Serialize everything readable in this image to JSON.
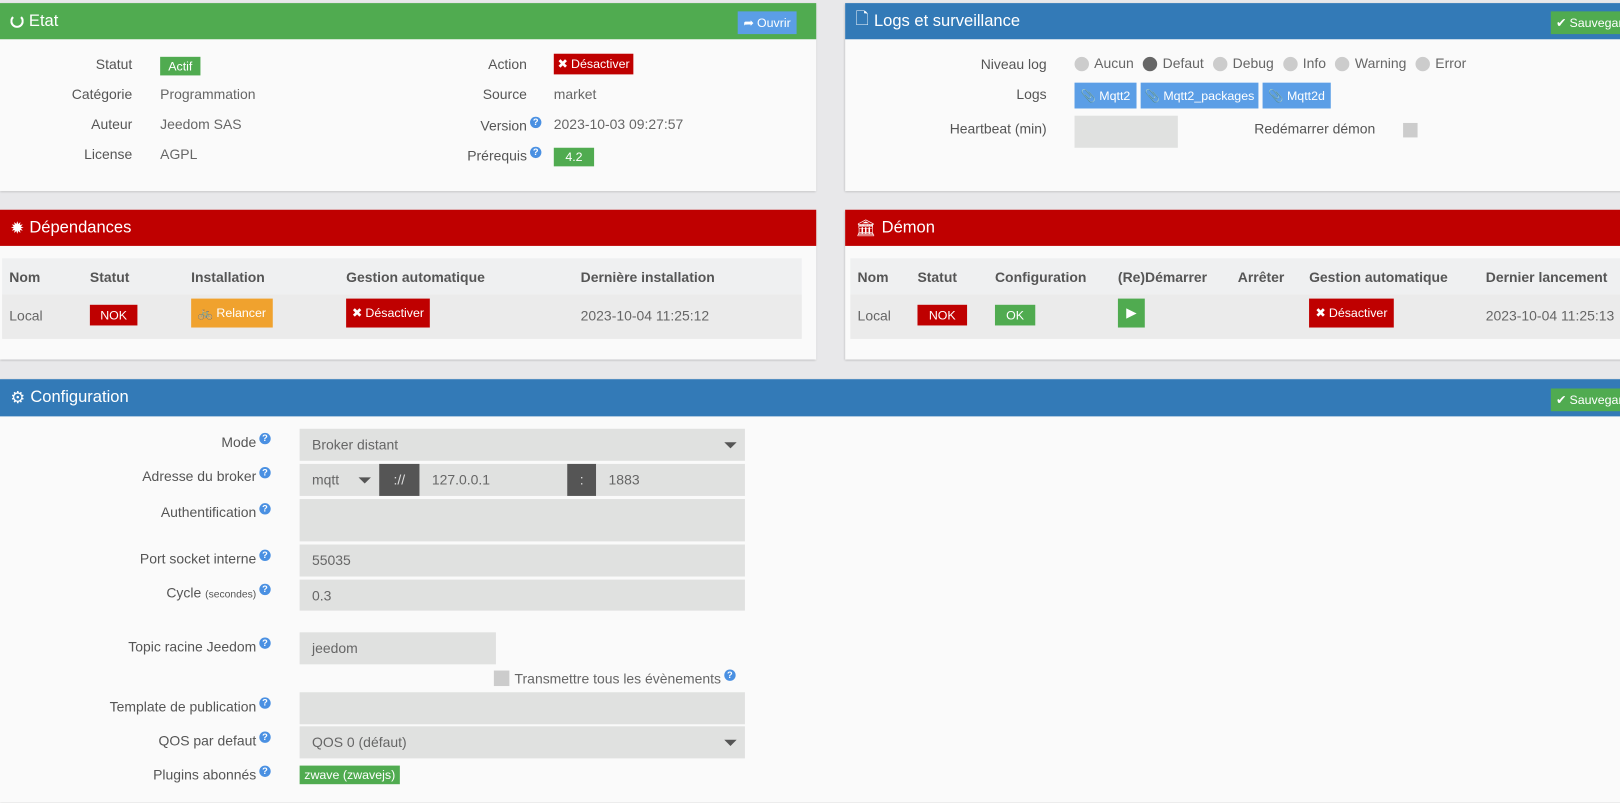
{
  "colors": {
    "success": "#50ab50",
    "primary": "#337ab7",
    "danger": "#bf0000",
    "warning": "#f0a22e",
    "info": "#5b9ee6"
  },
  "etat": {
    "title": "Etat",
    "icon": "circle-notch-icon",
    "open_button": "Ouvrir",
    "rows": [
      {
        "label": "Statut",
        "value": "Actif"
      },
      {
        "label": "Catégorie",
        "value": "Programmation"
      },
      {
        "label": "Auteur",
        "value": "Jeedom SAS"
      },
      {
        "label": "License",
        "value": "AGPL"
      }
    ],
    "right": [
      {
        "label": "Action",
        "value": "Désactiver"
      },
      {
        "label": "Source",
        "value": "market"
      },
      {
        "label": "Version",
        "value": "2023-10-03 09:27:57"
      },
      {
        "label": "Prérequis",
        "value": "4.2"
      }
    ]
  },
  "logs": {
    "title": "Logs et surveillance",
    "save_button": "Sauvegarder",
    "niveau_label": "Niveau log",
    "levels": [
      "Aucun",
      "Defaut",
      "Debug",
      "Info",
      "Warning",
      "Error"
    ],
    "selected_level": "Defaut",
    "logs_label": "Logs",
    "log_buttons": [
      "Mqtt2",
      "Mqtt2_packages",
      "Mqtt2d"
    ],
    "heartbeat_label": "Heartbeat (min)",
    "heartbeat_value": "",
    "restart_label": "Redémarrer démon",
    "restart_checked": false
  },
  "dependances": {
    "title": "Dépendances",
    "headers": [
      "Nom",
      "Statut",
      "Installation",
      "Gestion automatique",
      "Dernière installation"
    ],
    "row": {
      "nom": "Local",
      "statut": "NOK",
      "installation": "Relancer",
      "gestion": "Désactiver",
      "derniere": "2023-10-04 11:25:12"
    }
  },
  "demon": {
    "title": "Démon",
    "headers": [
      "Nom",
      "Statut",
      "Configuration",
      "(Re)Démarrer",
      "Arrêter",
      "Gestion automatique",
      "Dernier lancement"
    ],
    "row": {
      "nom": "Local",
      "statut": "NOK",
      "configuration": "OK",
      "gestion": "Désactiver",
      "dernier": "2023-10-04 11:25:13"
    }
  },
  "config": {
    "title": "Configuration",
    "save_button": "Sauvegarder",
    "mode_label": "Mode",
    "mode_value": "Broker distant",
    "broker_label": "Adresse du broker",
    "protocol": "mqtt",
    "sep1": "://",
    "host": "127.0.0.1",
    "sep2": ":",
    "port": "1883",
    "auth_label": "Authentification",
    "auth_value": "",
    "socket_label": "Port socket interne",
    "socket_value": "55035",
    "cycle_label": "Cycle",
    "cycle_unit": "(secondes)",
    "cycle_value": "0.3",
    "topic_label": "Topic racine Jeedom",
    "topic_value": "jeedom",
    "transmit_label": "Transmettre tous les évènements",
    "transmit_checked": false,
    "template_label": "Template de publication",
    "template_value": "",
    "qos_label": "QOS par defaut",
    "qos_value": "QOS 0 (défaut)",
    "plugins_label": "Plugins abonnés",
    "plugins": [
      "zwave (zwavejs)"
    ],
    "help": "?"
  }
}
